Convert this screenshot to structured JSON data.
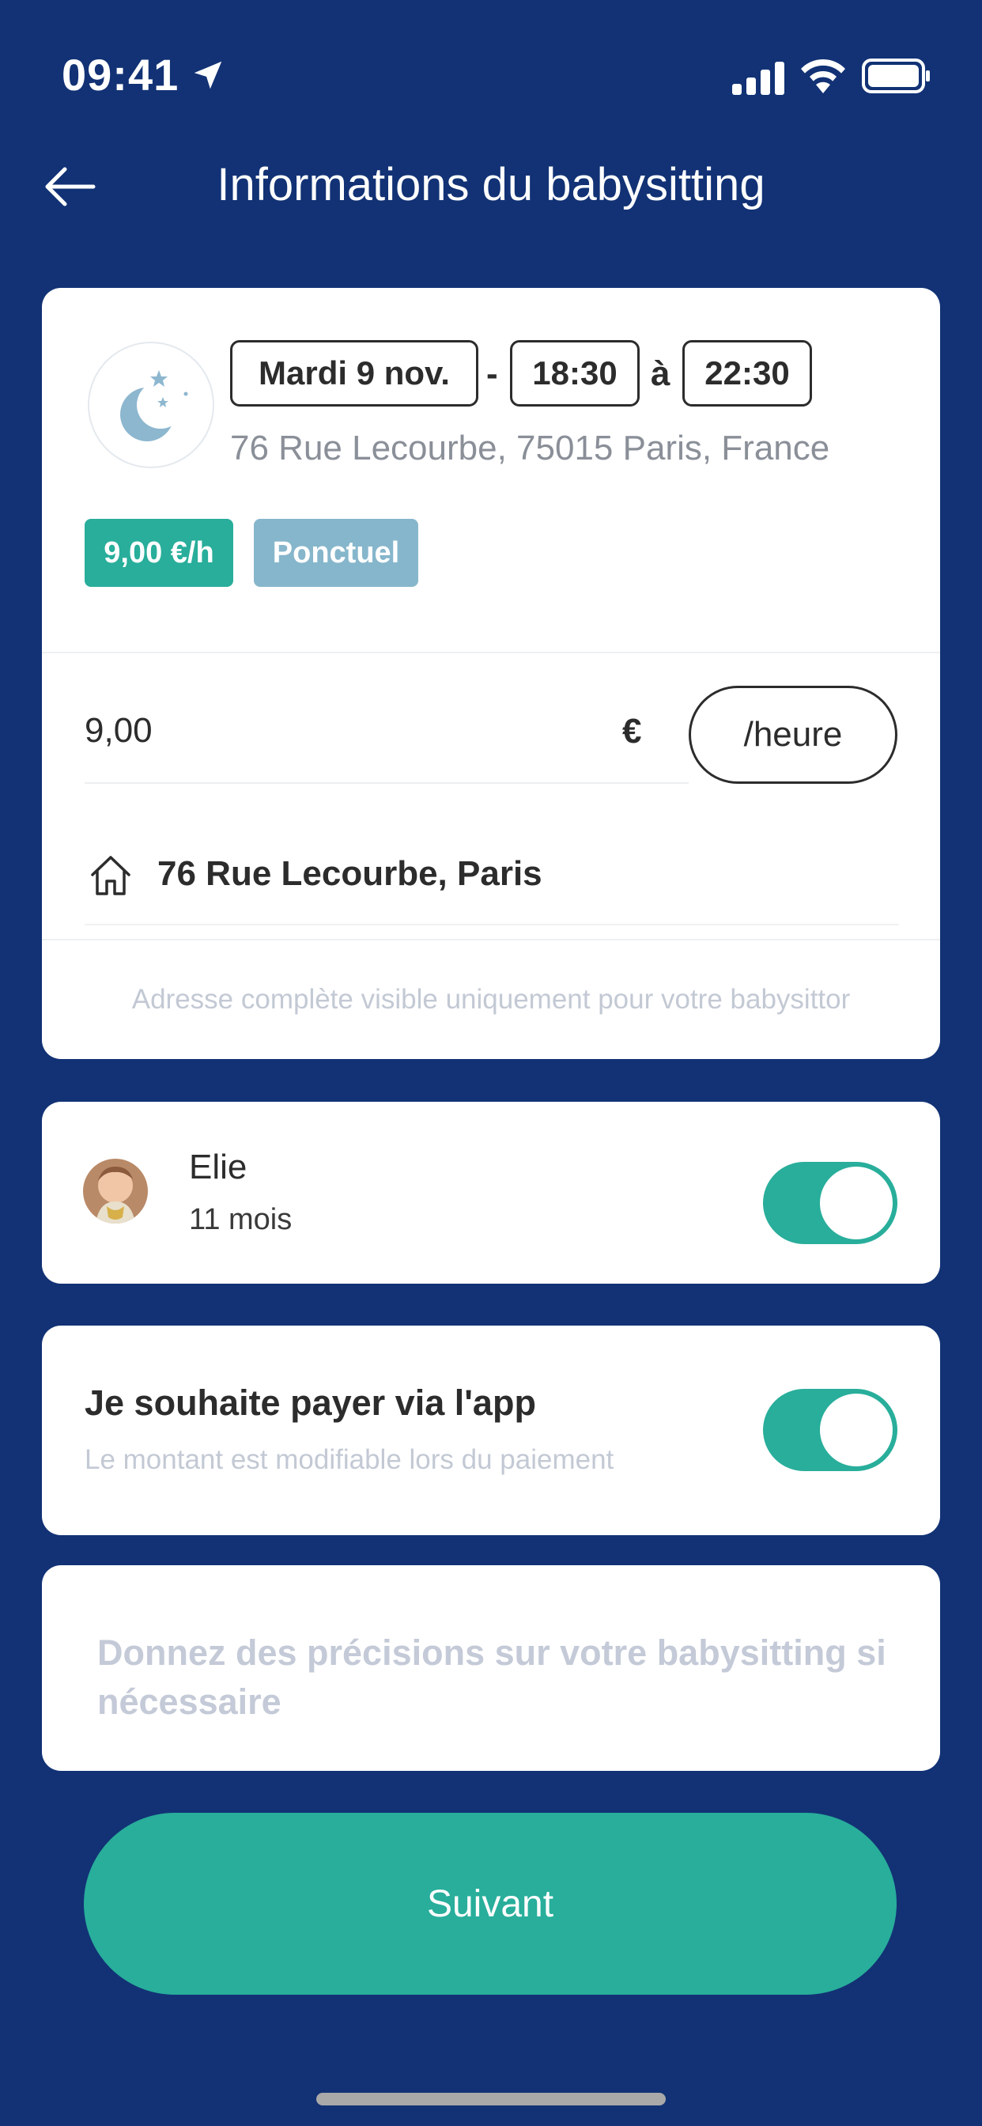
{
  "status_bar": {
    "time": "09:41",
    "icons": [
      "location-arrow-icon",
      "signal-icon",
      "wifi-icon",
      "battery-icon"
    ]
  },
  "header": {
    "title": "Informations du babysitting",
    "back_icon": "arrow-left-icon"
  },
  "booking": {
    "date": "Mardi 9 nov.",
    "separator_dash": "-",
    "start_time": "18:30",
    "separator_to": "à",
    "end_time": "22:30",
    "address": "76 Rue Lecourbe, 75015 Paris, France",
    "rate_tag": "9,00 €/h",
    "type_tag": "Ponctuel",
    "rate_value": "9,00",
    "currency": "€",
    "unit_label": "/heure",
    "home_address": "76 Rue Lecourbe, Paris",
    "address_note": "Adresse complète visible uniquement pour votre babysittor"
  },
  "child": {
    "name": "Elie",
    "age": "11 mois",
    "enabled": true
  },
  "payment": {
    "title": "Je souhaite payer via l'app",
    "subtitle": "Le montant est modifiable lors du paiement",
    "enabled": true
  },
  "notes": {
    "placeholder": "Donnez des précisions sur votre babysitting si nécessaire"
  },
  "footer": {
    "next_label": "Suivant"
  },
  "colors": {
    "background": "#123275",
    "accent": "#28ae9b",
    "tag_secondary": "#86b6cb"
  }
}
